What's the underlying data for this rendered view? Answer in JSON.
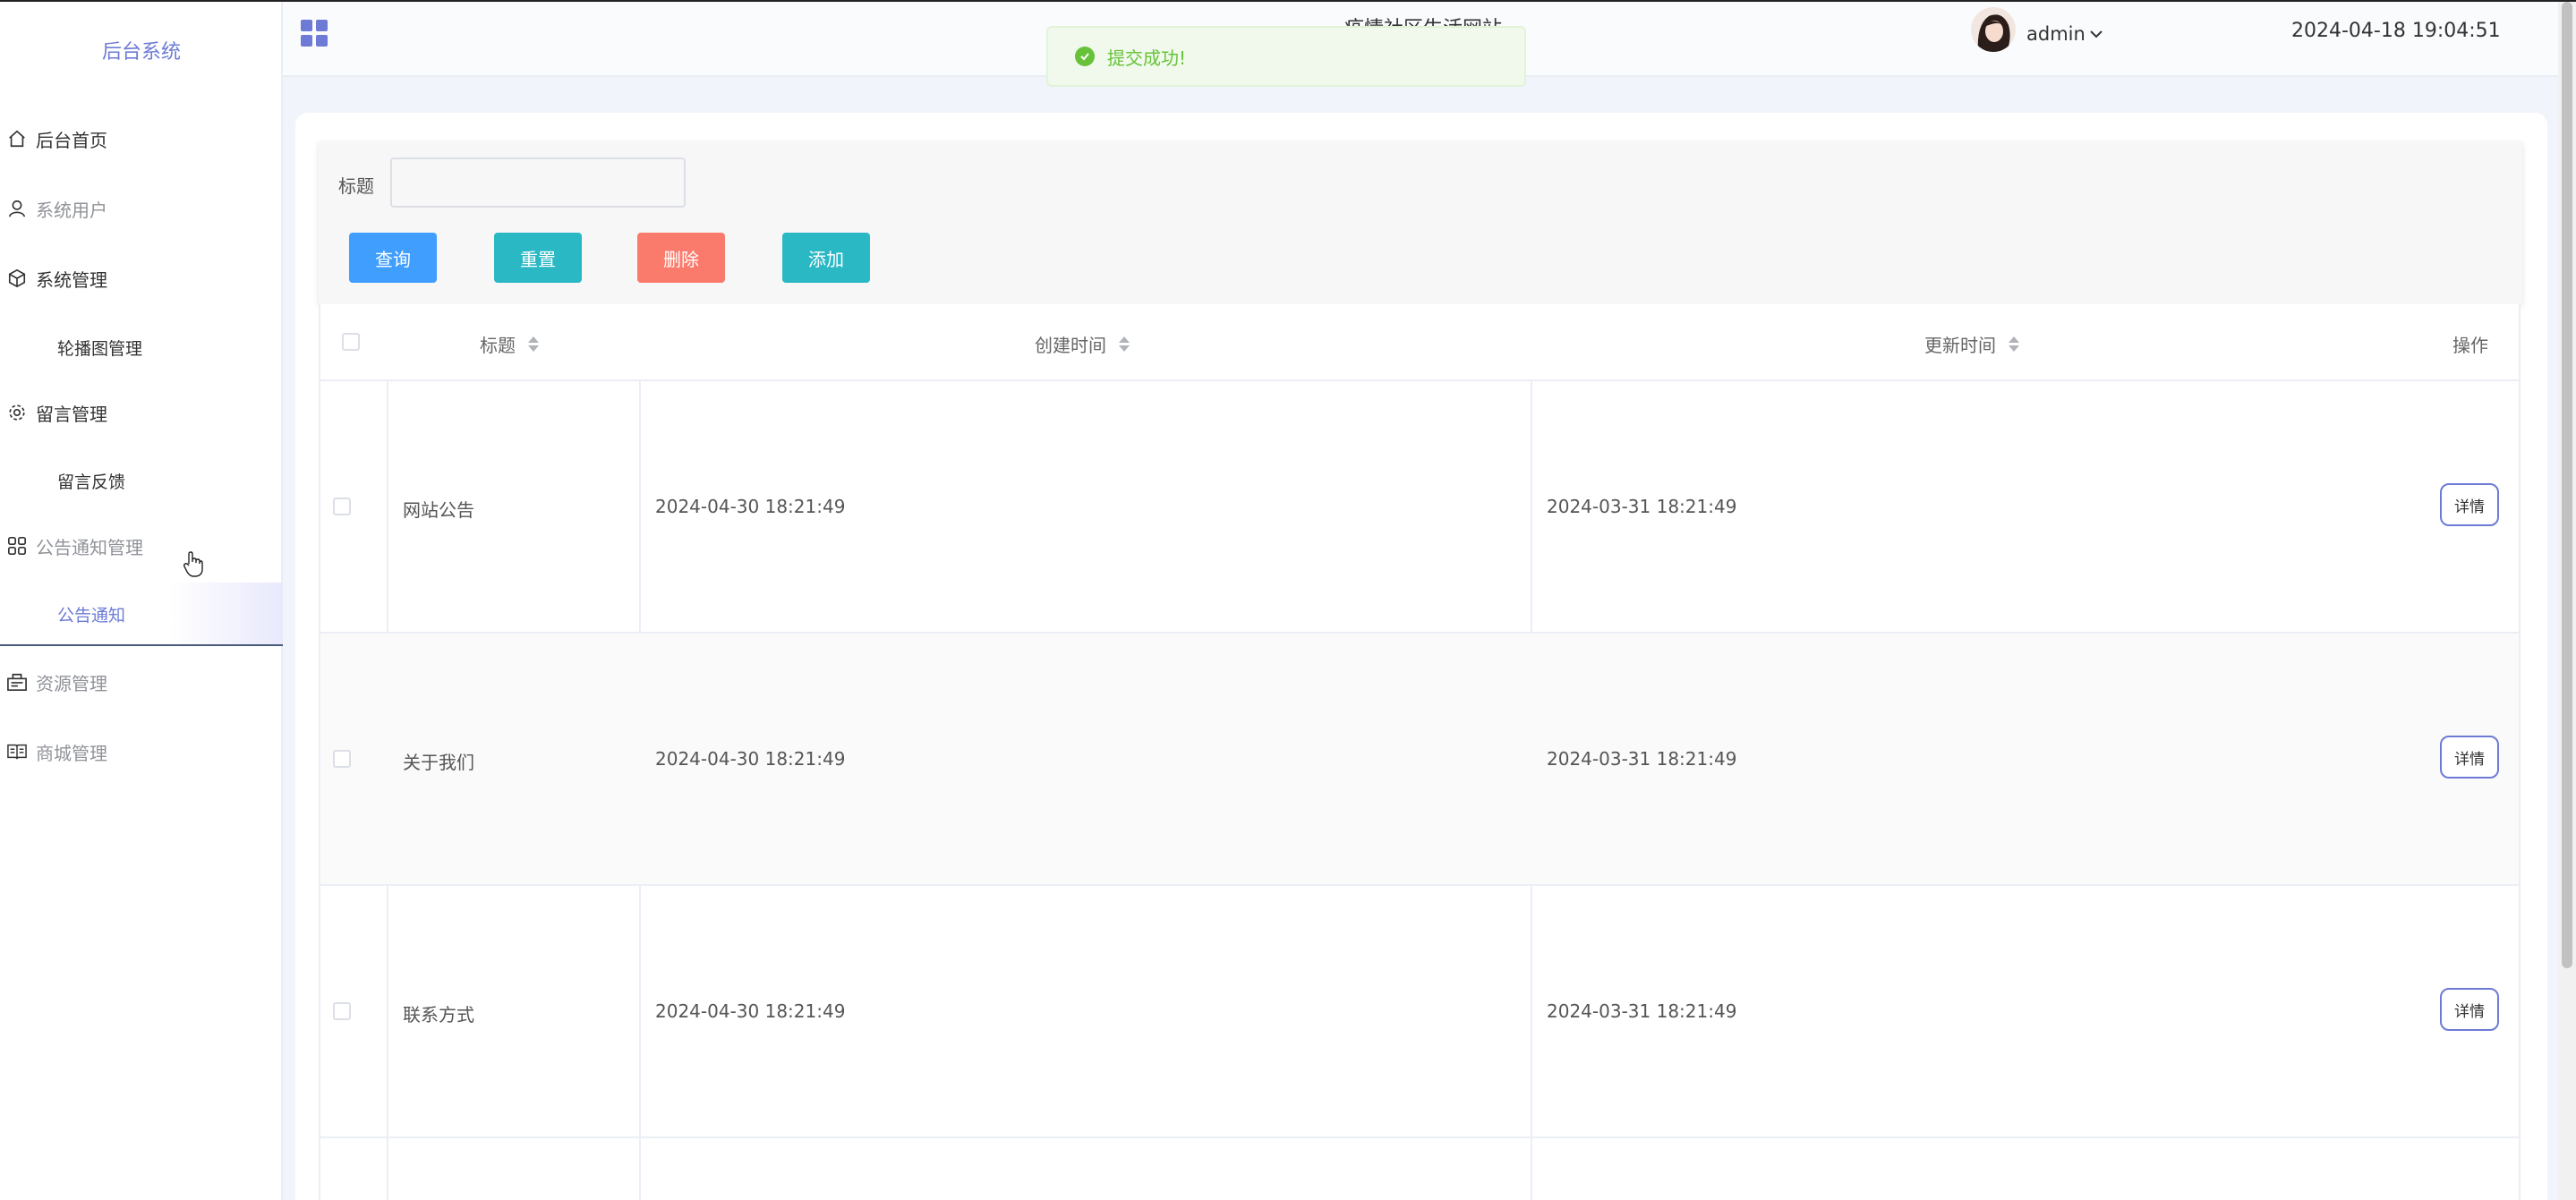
{
  "sidebar": {
    "brand": "后台系统",
    "items": [
      {
        "label": "后台首页",
        "icon": "home-icon",
        "top": 0
      },
      {
        "label": "系统用户",
        "icon": "user-icon"
      },
      {
        "label": "系统管理",
        "icon": "box-icon"
      },
      {
        "label": "轮播图管理",
        "sub": true
      },
      {
        "label": "留言管理",
        "icon": "gear-icon"
      },
      {
        "label": "留言反馈",
        "sub": true
      },
      {
        "label": "公告通知管理",
        "icon": "apps-icon"
      },
      {
        "label": "公告通知",
        "sub": true,
        "active": true
      },
      {
        "label": "资源管理",
        "icon": "resource-icon"
      },
      {
        "label": "商城管理",
        "icon": "book-icon"
      }
    ]
  },
  "header": {
    "title": "疫情社区生活网站",
    "user": "admin",
    "datetime": "2024-04-18 19:04:51"
  },
  "toast": {
    "message": "提交成功!",
    "color": "#67c23a"
  },
  "search": {
    "label": "标题",
    "placeholder": "",
    "value": ""
  },
  "buttons": {
    "query": "查询",
    "reset": "重置",
    "delete": "删除",
    "add": "添加"
  },
  "table": {
    "columns": {
      "title": "标题",
      "created": "创建时间",
      "updated": "更新时间",
      "actions": "操作"
    },
    "rows": [
      {
        "title": "网站公告",
        "created": "2024-04-30 18:21:49",
        "updated": "2024-03-31 18:21:49",
        "action": "详情"
      },
      {
        "title": "关于我们",
        "created": "2024-04-30 18:21:49",
        "updated": "2024-03-31 18:21:49",
        "action": "详情"
      },
      {
        "title": "联系方式",
        "created": "2024-04-30 18:21:49",
        "updated": "2024-03-31 18:21:49",
        "action": "详情"
      }
    ]
  },
  "colors": {
    "accent": "#6d7bd6",
    "query": "#409eff",
    "teal": "#2bb8c5",
    "danger": "#fa7b6b"
  }
}
